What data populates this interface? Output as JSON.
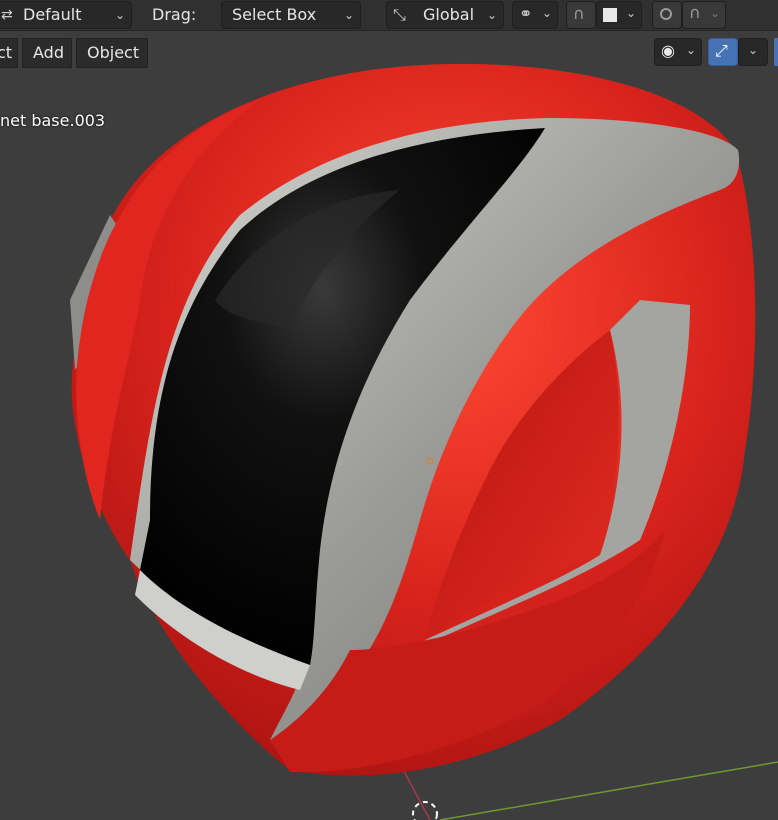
{
  "header": {
    "orientation_value": "Default",
    "drag_label": "Drag:",
    "drag_value": "Select Box",
    "transform_orientation": "Global"
  },
  "viewport_menu": {
    "select_partial": "ct",
    "add": "Add",
    "object": "Object"
  },
  "viewport": {
    "object_name": "net base.003"
  },
  "icons": {
    "orientation": "orientation-arrows-icon",
    "transform_pivot": "transform-axes-icon",
    "link": "link-icon",
    "snap": "snap-magnet-icon",
    "snap_target": "snap-square-icon",
    "proportional": "proportional-edit-icon",
    "falloff": "falloff-curve-icon",
    "visibility": "eye-icon",
    "gizmo": "gizmo-arrows-icon"
  },
  "colors": {
    "helmet_red": "#d3201c",
    "helmet_trim": "#a9a9a6",
    "visor": "#060606",
    "accent_blue": "#4772b3"
  }
}
